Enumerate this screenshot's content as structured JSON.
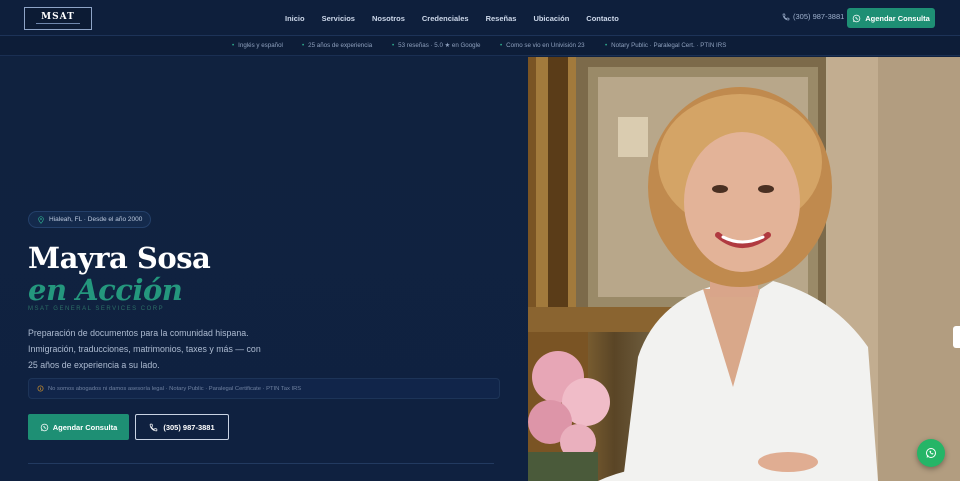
{
  "brand": {
    "logo_text": "MSAT"
  },
  "nav": {
    "items": [
      {
        "label": "Inicio"
      },
      {
        "label": "Servicios"
      },
      {
        "label": "Nosotros"
      },
      {
        "label": "Credenciales"
      },
      {
        "label": "Reseñas"
      },
      {
        "label": "Ubicación"
      },
      {
        "label": "Contacto"
      }
    ],
    "phone": "(305) 987-3881",
    "cta_label": "Agendar Consulta"
  },
  "infobar": {
    "items": [
      "Inglés y español",
      "25 años de experiencia",
      "53 reseñas · 5.0 ★ en Google",
      "Como se vio en Univisión 23",
      "Notary Public · Paralegal Cert. · PTIN IRS"
    ]
  },
  "hero": {
    "location_badge": "Hialeah, FL · Desde el año 2000",
    "name": "Mayra Sosa",
    "name_accent": "en Acción",
    "corp": "MSAT GENERAL SERVICES CORP",
    "description_lines": [
      "Preparación de documentos para la comunidad hispana.",
      "Inmigración, traducciones, matrimonios, taxes y más — con",
      "25 años de experiencia a su lado."
    ],
    "disclaimer": "No somos abogados ni damos asesoría legal · Notary Public · Paralegal Certificate · PTIN Tax IRS",
    "primary_cta": "Agendar Consulta",
    "secondary_cta": "(305) 987-3881"
  },
  "colors": {
    "navy": "#0f2140",
    "teal": "#1e8f74",
    "whatsapp": "#25b567"
  },
  "icons": {
    "whatsapp": "whatsapp-icon",
    "phone": "phone-icon",
    "location": "location-pin-icon",
    "info": "info-circle-icon"
  }
}
